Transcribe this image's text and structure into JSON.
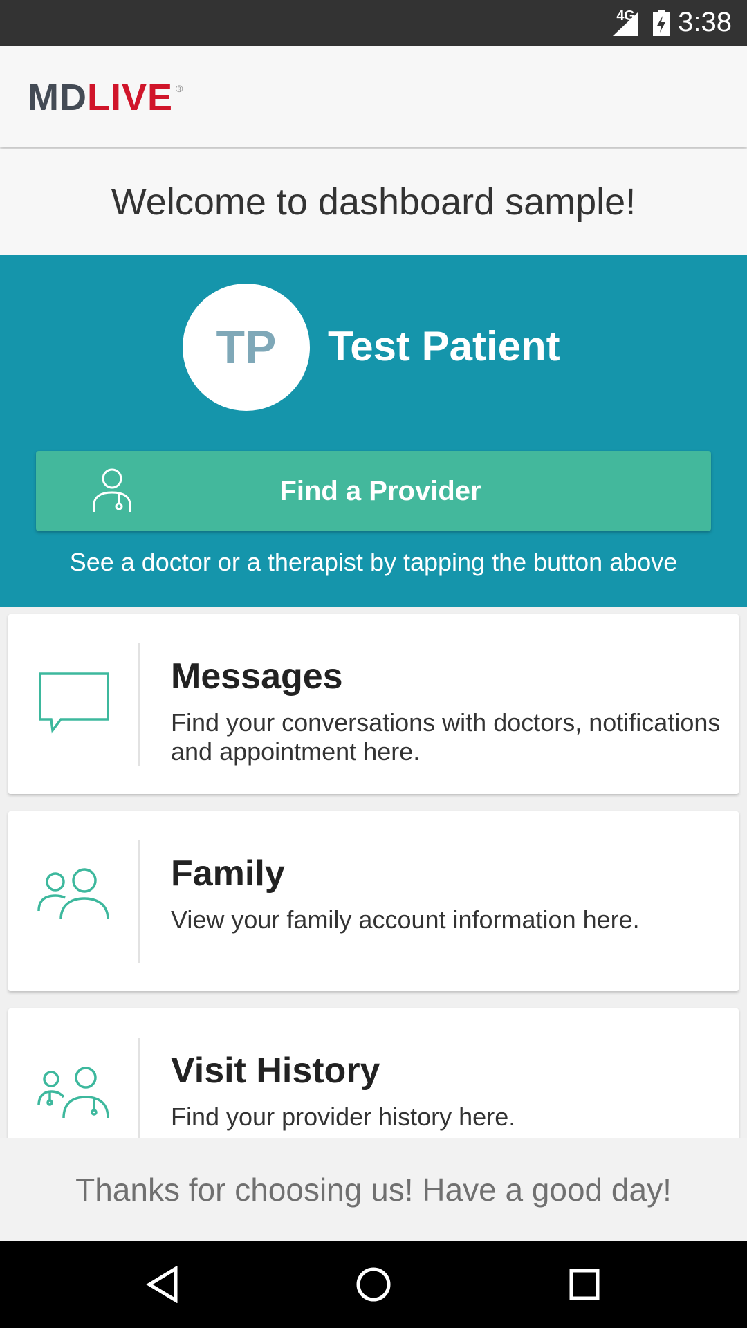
{
  "status_bar": {
    "network": "4G",
    "time": "3:38"
  },
  "app_bar": {
    "logo_part1": "MD",
    "logo_part2": "LIVE",
    "logo_mark": "®"
  },
  "welcome": "Welcome to dashboard sample!",
  "profile": {
    "initials": "TP",
    "name": "Test Patient"
  },
  "find_provider": {
    "label": "Find a Provider",
    "hint": "See a doctor or a therapist by tapping the button above",
    "icon": "provider-icon"
  },
  "cards": [
    {
      "title": "Messages",
      "description": "Find your conversations with doctors, notifications and appointment here.",
      "icon": "chat-icon"
    },
    {
      "title": "Family",
      "description": "View your family account information here.",
      "icon": "family-icon"
    },
    {
      "title": "Visit History",
      "description": "Find your provider history here.",
      "icon": "visit-history-icon"
    }
  ],
  "footer": "Thanks for choosing us! Have a good day!",
  "colors": {
    "hero": "#1595ab",
    "button": "#43b89c",
    "icon": "#3db89d",
    "brand_red": "#d0152a",
    "brand_gray": "#444b55"
  }
}
